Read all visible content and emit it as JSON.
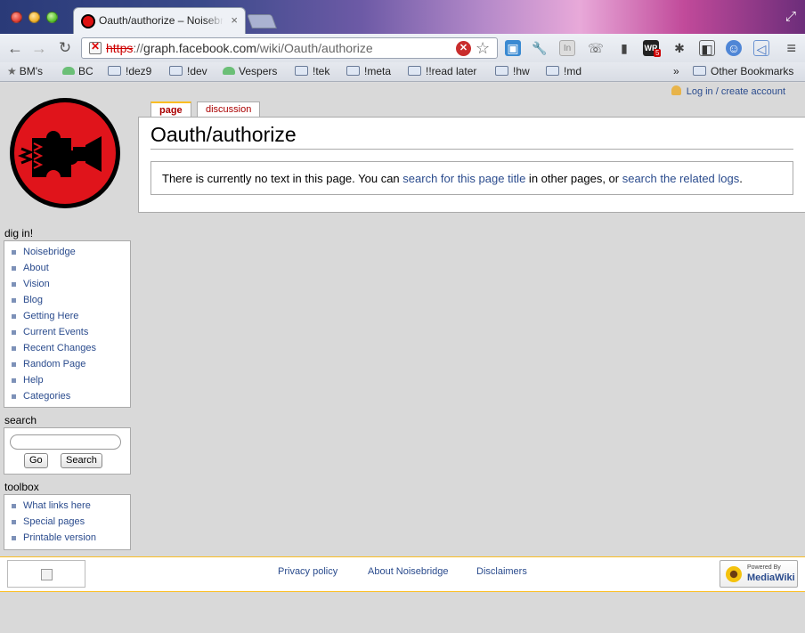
{
  "browser": {
    "tab_title": "Oauth/authorize – Noisebridge",
    "tab_close": "×",
    "url_scheme": "https",
    "url_sep": "://",
    "url_host": "graph.facebook.com",
    "url_path": "/wiki/Oauth/authorize",
    "bookmarks": [
      {
        "label": "BM's",
        "kind": "star"
      },
      {
        "label": "BC",
        "kind": "leaf"
      },
      {
        "label": "!dez9",
        "kind": "folder"
      },
      {
        "label": "!dev",
        "kind": "folder"
      },
      {
        "label": "Vespers",
        "kind": "leaf"
      },
      {
        "label": "!tek",
        "kind": "folder"
      },
      {
        "label": "!meta",
        "kind": "folder"
      },
      {
        "label": "!!read later",
        "kind": "folder"
      },
      {
        "label": "!hw",
        "kind": "folder"
      },
      {
        "label": "!md",
        "kind": "folder"
      }
    ],
    "bookmarks_overflow": "»",
    "other_bookmarks": "Other Bookmarks",
    "extension_badge_wr": "WR",
    "extension_badge_count": "5",
    "extension_in": "In"
  },
  "page": {
    "personal_link": "Log in / create account",
    "tabs": [
      {
        "label": "page",
        "active": true
      },
      {
        "label": "discussion",
        "active": false
      }
    ],
    "heading": "Oauth/authorize",
    "notice": {
      "text_before": "There is currently no text in this page. You can ",
      "link1": "search for this page title",
      "text_middle": " in other pages, or ",
      "link2": "search the related logs",
      "text_after": "."
    }
  },
  "sidebar": {
    "navigation_title": "dig in!",
    "navigation": [
      "Noisebridge",
      "About",
      "Vision",
      "Blog",
      "Getting Here",
      "Current Events",
      "Recent Changes",
      "Random Page",
      "Help",
      "Categories"
    ],
    "search_title": "search",
    "go_label": "Go",
    "search_label": "Search",
    "toolbox_title": "toolbox",
    "toolbox": [
      "What links here",
      "Special pages",
      "Printable version"
    ]
  },
  "footer": {
    "links": [
      "Privacy policy",
      "About Noisebridge",
      "Disclaimers"
    ],
    "powered_small": "Powered By",
    "powered_big": "MediaWiki"
  },
  "colors": {
    "link": "#2a4b8d",
    "tab_active": "#a00",
    "accent_border": "#fabd23",
    "logo_red": "#e0141b"
  }
}
